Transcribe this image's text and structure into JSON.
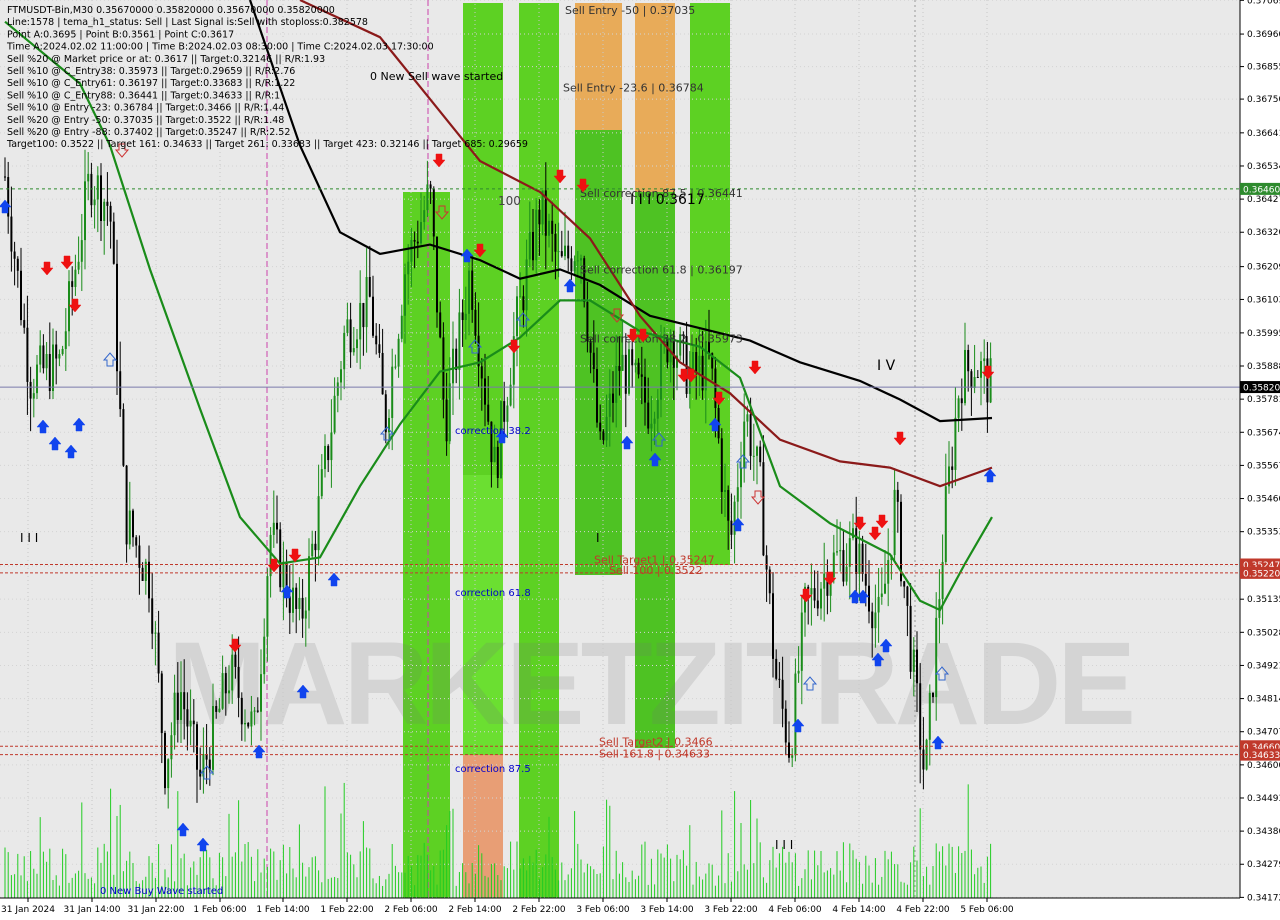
{
  "header": {
    "info_lines": [
      "FTMUSDT-Bin,M30  0.35670000 0.35820000 0.35670000 0.35820000",
      "Line:1578  |  tema_h1_status: Sell  |  Last Signal is:Sell with stoploss:0.382578",
      "Point A:0.3695  |  Point B:0.3561  |  Point C:0.3617",
      "Time A:2024.02.02 11:00:00  |  Time B:2024.02.03 08:30:00  |  Time C:2024.02.03 17:30:00",
      "Sell %20 @ Market price or at: 0.3617  ||  Target:0.32146  ||  R/R:1.93",
      "Sell %10 @ C_Entry38: 0.35973  ||  Target:0.29659  ||  R/R:2.76",
      "Sell %10 @ C_Entry61: 0.36197  ||  Target:0.33683  ||  R/R:1.22",
      "Sell %10 @ C_Entry88: 0.36441  ||  Target:0.34633  ||  R/R:1",
      "Sell %10 @ Entry -23: 0.36784  ||  Target:0.3466  ||  R/R:1.44",
      "Sell %20 @ Entry -50: 0.37035  ||  Target:0.3522  ||  R/R:1.48",
      "Sell %20 @ Entry -88: 0.37402  ||  Target:0.35247  ||  R/R:2.52",
      "Target100: 0.3522  ||  Target 161: 0.34633  ||  Target 261: 0.33683  ||  Target 423: 0.32146  ||  Target 685: 0.29659"
    ]
  },
  "watermark": "MARKETZITRADE",
  "chart_data": {
    "type": "candlestick",
    "symbol": "FTMUSDT-Bin",
    "timeframe": "M30",
    "ylim": [
      0.3417,
      0.3707
    ],
    "y_ticks": [
      "0.37069",
      "0.36960",
      "0.36855",
      "0.36750",
      "0.36641",
      "0.36534",
      "0.36427",
      "0.36320",
      "0.36209",
      "0.36103",
      "0.35995",
      "0.35888",
      "0.35781",
      "0.35674",
      "0.35567",
      "0.35460",
      "0.35353",
      "0.35242",
      "0.35135",
      "0.35028",
      "0.34921",
      "0.34814",
      "0.34707",
      "0.34600",
      "0.34493",
      "0.34386",
      "0.34279",
      "0.34172"
    ],
    "x_ticks": [
      "31 Jan 2024",
      "31 Jan 14:00",
      "31 Jan 22:00",
      "1 Feb 06:00",
      "1 Feb 14:00",
      "1 Feb 22:00",
      "2 Feb 06:00",
      "2 Feb 14:00",
      "2 Feb 22:00",
      "3 Feb 06:00",
      "3 Feb 14:00",
      "3 Feb 22:00",
      "4 Feb 06:00",
      "4 Feb 14:00",
      "4 Feb 22:00",
      "5 Feb 06:00"
    ],
    "current_price": "0.35820",
    "price_tags": [
      {
        "value": 0.3646,
        "label": "0.36460",
        "color": "#2e8b2e"
      },
      {
        "value": 0.3582,
        "label": "0.35820",
        "color": "#000000"
      },
      {
        "value": 0.35247,
        "label": "0.35247",
        "color": "#c0392b"
      },
      {
        "value": 0.3522,
        "label": "0.35220",
        "color": "#c0392b"
      },
      {
        "value": 0.3466,
        "label": "0.34660",
        "color": "#c0392b"
      },
      {
        "value": 0.34633,
        "label": "0.34633",
        "color": "#c0392b"
      }
    ],
    "levels": [
      {
        "name": "Sell Entry -50",
        "value": 0.37035,
        "label": "Sell Entry -50 | 0.37035"
      },
      {
        "name": "Sell Entry -23.6",
        "value": 0.36784,
        "label": "Sell Entry -23.6 | 0.36784"
      },
      {
        "name": "Sell correction 87.5",
        "value": 0.36441,
        "label": "Sell correction 87.5 | 0.36441"
      },
      {
        "name": "Sell correction 61.8",
        "value": 0.36197,
        "label": "Sell correction 61.8 | 0.36197"
      },
      {
        "name": "Sell correction 38.2",
        "value": 0.35973,
        "label": "Sell correction 38.2 | 0.35973"
      },
      {
        "name": "Sell Target1",
        "value": 0.35247,
        "label": "Sell Target1 | 0.35247"
      },
      {
        "name": "Sell 100",
        "value": 0.3522,
        "label": "Sell 100 | 0.3522"
      },
      {
        "name": "Sell Target2",
        "value": 0.3466,
        "label": "Sell Target2 | 0.3466"
      },
      {
        "name": "Sell 161.8",
        "value": 0.34633,
        "label": "Sell 161.8 | 0.34633"
      }
    ],
    "annotations": [
      {
        "text": "0 New Sell wave started",
        "color": "#000000"
      },
      {
        "text": "0 New Buy Wave started",
        "color": "#0000cc"
      },
      {
        "text": "correction 38.2",
        "color": "#0000cc"
      },
      {
        "text": "correction 61.8",
        "color": "#0000cc"
      },
      {
        "text": "correction 87.5",
        "color": "#0000cc"
      },
      {
        "text": "I I I 0.3617",
        "color": "#000000"
      },
      {
        "text": "100",
        "color": "#444444"
      },
      {
        "text": "I V",
        "color": "#000000"
      },
      {
        "text": "I I I",
        "color": "#000000"
      },
      {
        "text": "I",
        "color": "#000000"
      }
    ],
    "colors": {
      "up": "#1a8c1a",
      "down": "#000000",
      "ema_fast": "#1a8c1a",
      "ema_mid": "#8b1a1a",
      "ema_slow": "#000000",
      "bright_green": "#44cc00",
      "orange": "#e8a040",
      "salmon": "#e89060",
      "target_red": "#c0392b"
    }
  }
}
